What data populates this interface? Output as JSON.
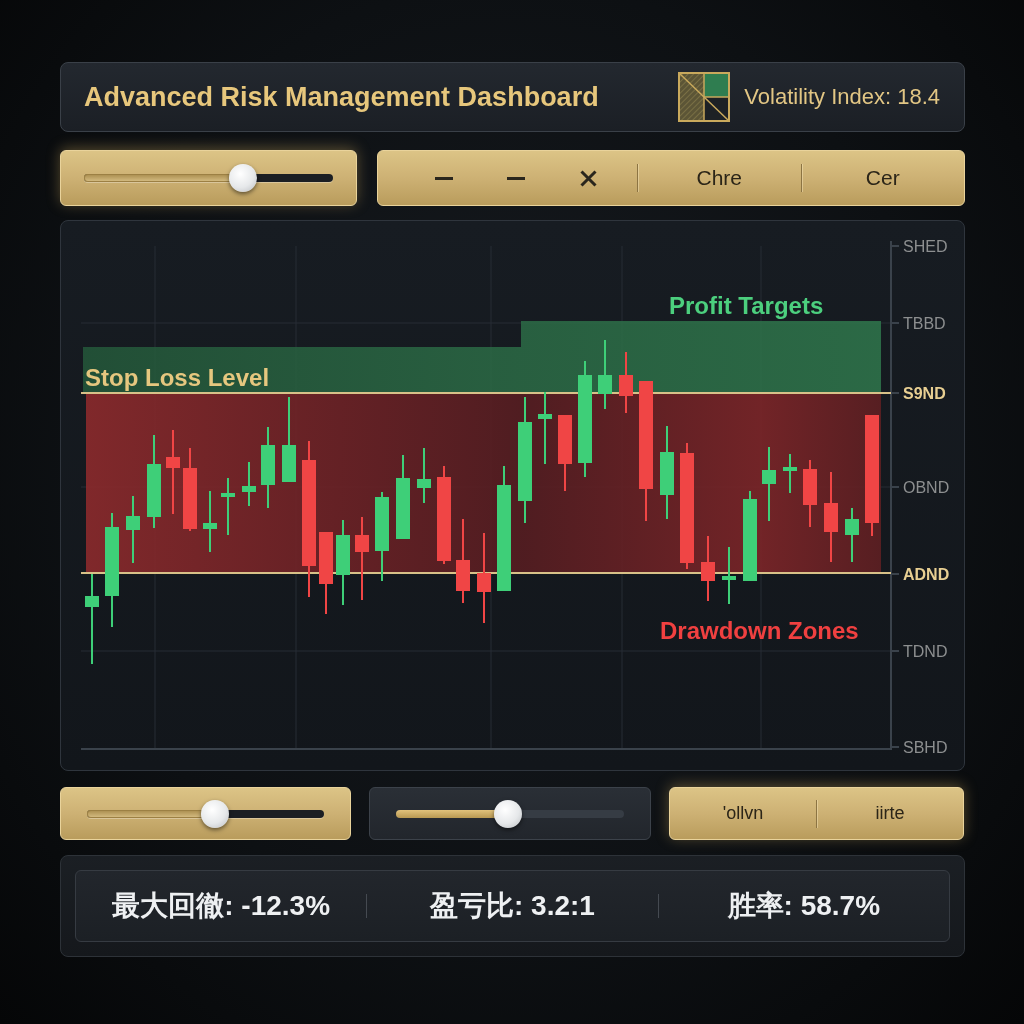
{
  "header": {
    "title": "Advanced Risk Management Dashboard",
    "volatility": "Volatility Index: 18.4"
  },
  "top_controls": {
    "slider": {
      "level": 0.64
    },
    "toolbar": [
      {
        "kind": "minus"
      },
      {
        "kind": "minus"
      },
      {
        "kind": "close"
      },
      {
        "kind": "text",
        "label": "Chre"
      },
      {
        "kind": "text",
        "label": "Cer"
      }
    ]
  },
  "chart": {
    "profit_label": "Profit Targets",
    "stop_loss_label": "Stop Loss Level",
    "drawdown_label": "Drawdown Zones",
    "axis_labels": [
      {
        "text": "SHED",
        "highlighted": false
      },
      {
        "text": "TBBD",
        "highlighted": false
      },
      {
        "text": "S9ND",
        "highlighted": true
      },
      {
        "text": "OBND",
        "highlighted": false
      },
      {
        "text": "ADND",
        "highlighted": true
      },
      {
        "text": "TDND",
        "highlighted": false
      },
      {
        "text": "SBHD",
        "highlighted": false
      }
    ]
  },
  "bottom_controls": {
    "sliders": [
      {
        "kind": "gold",
        "level": 0.54
      },
      {
        "kind": "dark",
        "level": 0.49
      }
    ],
    "buttons": [
      "'ollvn",
      "iirte"
    ]
  },
  "stats": [
    "最大回徹: -12.3%",
    "盈亏比: 3.2:1",
    "胜率: 58.7%"
  ]
}
